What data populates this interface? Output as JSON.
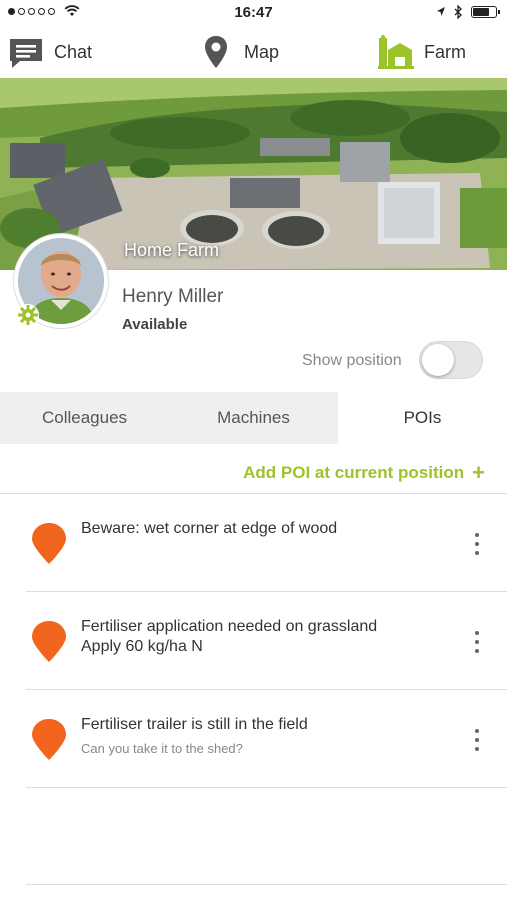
{
  "status_bar": {
    "time": "16:47",
    "battery_level": 0.75
  },
  "nav": {
    "chat_label": "Chat",
    "map_label": "Map",
    "farm_label": "Farm",
    "accent_color": "#9cc32a"
  },
  "header": {
    "farm_name": "Home Farm"
  },
  "profile": {
    "name": "Henry Miller",
    "status": "Available",
    "show_position_label": "Show position",
    "show_position_on": false
  },
  "tabs": [
    {
      "label": "Colleagues",
      "active": false
    },
    {
      "label": "Machines",
      "active": false
    },
    {
      "label": "POIs",
      "active": true
    }
  ],
  "add_poi_label": "Add POI at current position",
  "pois": [
    {
      "title": "Beware: wet corner at edge of wood",
      "subtitle": ""
    },
    {
      "title": "Fertiliser application needed on grassland",
      "subtitle": "Apply 60 kg/ha N"
    },
    {
      "title": "Fertiliser trailer is still in the field",
      "subtitle": "Can you take it to the shed?"
    }
  ],
  "pin_color": "#f2651f"
}
